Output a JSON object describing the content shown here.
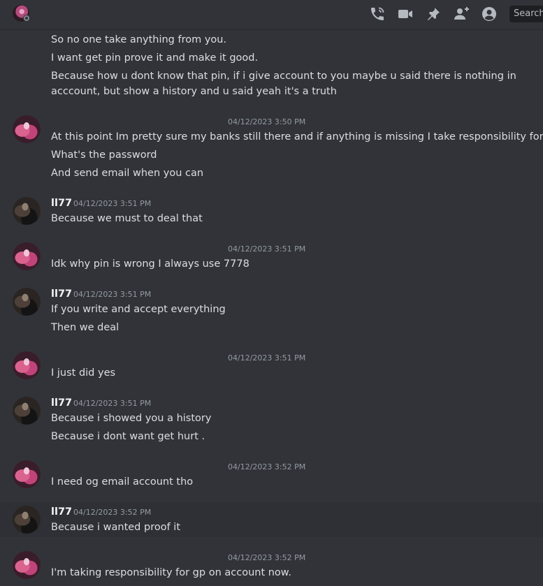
{
  "header": {
    "search_label": "Search"
  },
  "icons": [
    "phone-call-icon",
    "video-icon",
    "pin-icon",
    "add-member-icon",
    "user-profile-icon"
  ],
  "accent": "#313338",
  "messages": [
    {
      "text": "So no one take anything from you."
    },
    {
      "text": "I want get pin prove it and make it good."
    },
    {
      "text": "Because how u dont know that pin, if i give account to you maybe u said there is nothing in acccount, but show a history and u said yeah it's a truth"
    },
    {
      "ts": "04/12/2023 3:50 PM",
      "text": "At this point Im pretty sure my banks still there and if anything is missing I take responsibility for it"
    },
    {
      "text": "What's the password"
    },
    {
      "text": "And send email when you can"
    },
    {
      "user": "ll77",
      "ts": "04/12/2023 3:51 PM",
      "text": "Because we must to deal that"
    },
    {
      "ts": "04/12/2023 3:51 PM",
      "text": "Idk why pin is wrong I always use 7778"
    },
    {
      "user": "ll77",
      "ts": "04/12/2023 3:51 PM",
      "text": "If you write and accept everything"
    },
    {
      "text": "Then we deal"
    },
    {
      "ts": "04/12/2023 3:51 PM",
      "text": "I just did yes"
    },
    {
      "user": "ll77",
      "ts": "04/12/2023 3:51 PM",
      "text": "Because i showed you a history"
    },
    {
      "text": "Because i dont want get hurt ."
    },
    {
      "ts": "04/12/2023 3:52 PM",
      "text": "I need og email account tho"
    },
    {
      "user": "ll77",
      "ts": "04/12/2023 3:52 PM",
      "text": "Because i wanted proof it"
    },
    {
      "ts": "04/12/2023 3:52 PM",
      "text": "I'm taking responsibility for gp on account now."
    }
  ]
}
